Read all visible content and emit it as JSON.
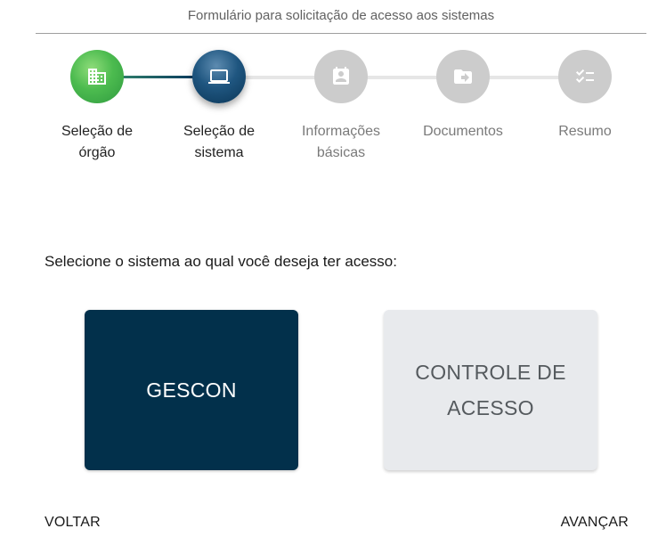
{
  "header": {
    "title": "Formulário para solicitação de acesso aos sistemas"
  },
  "stepper": {
    "steps": [
      {
        "label_line1": "Seleção de",
        "label_line2": "órgão",
        "icon": "building-icon",
        "state": "completed"
      },
      {
        "label_line1": "Seleção de",
        "label_line2": "sistema",
        "icon": "laptop-icon",
        "state": "active"
      },
      {
        "label_line1": "Informações",
        "label_line2": "básicas",
        "icon": "contact-card-icon",
        "state": "pending"
      },
      {
        "label_line1": "Documentos",
        "label_line2": "",
        "icon": "folder-arrow-icon",
        "state": "pending"
      },
      {
        "label_line1": "Resumo",
        "label_line2": "",
        "icon": "checklist-icon",
        "state": "pending"
      }
    ],
    "colors": {
      "completed": "#4cbb4f",
      "active": "#1f5680",
      "pending": "#cccccc"
    }
  },
  "main": {
    "prompt": "Selecione o sistema ao qual você deseja ter acesso:",
    "systems": [
      {
        "label": "GESCON",
        "selected": true
      },
      {
        "label": "CONTROLE DE ACESSO",
        "selected": false
      }
    ],
    "colors": {
      "selected_bg": "#02304b",
      "unselected_bg": "#e8eaed"
    }
  },
  "footer": {
    "back_label": "VOLTAR",
    "next_label": "AVANÇAR"
  }
}
